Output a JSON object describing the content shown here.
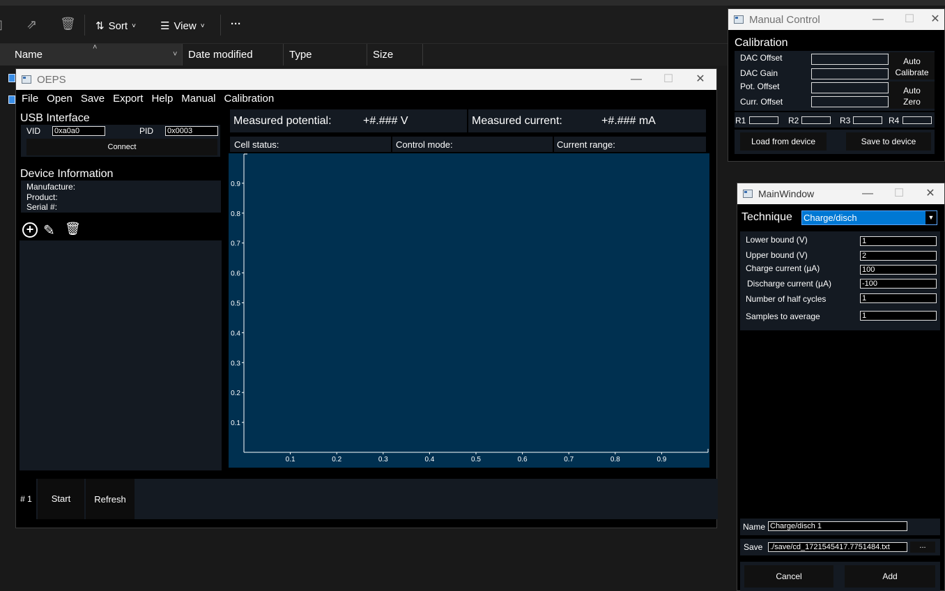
{
  "explorer": {
    "toolbar": {
      "sort_label": "Sort",
      "view_label": "View",
      "more_label": "···"
    },
    "columns": [
      "Name",
      "Date modified",
      "Type",
      "Size"
    ]
  },
  "oeps": {
    "title": "OEPS",
    "menu": [
      "File",
      "Open",
      "Save",
      "Export",
      "Help",
      "Manual",
      "Calibration"
    ],
    "usb": {
      "heading": "USB Interface",
      "vid_label": "VID",
      "vid_value": "0xa0a0",
      "pid_label": "PID",
      "pid_value": "0x0003",
      "connect_label": "Connect"
    },
    "device_info": {
      "heading": "Device Information",
      "manufacture": "Manufacture:",
      "product": "Product:",
      "serial": "Serial #:"
    },
    "readout": {
      "potential_label": "Measured potential:",
      "potential_value": "+#.### V",
      "current_label": "Measured current:",
      "current_value": "+#.### mA"
    },
    "status": {
      "cell": "Cell status:",
      "control": "Control mode:",
      "range": "Current range:"
    },
    "bottom": {
      "count": "# 1",
      "start_label": "Start",
      "refresh_label": "Refresh"
    }
  },
  "chart_data": {
    "type": "line",
    "series": [],
    "xlim": [
      0,
      1
    ],
    "ylim": [
      0,
      1
    ],
    "xticks": [
      "0.1",
      "0.2",
      "0.3",
      "0.4",
      "0.5",
      "0.6",
      "0.7",
      "0.8",
      "0.9"
    ],
    "yticks": [
      "0.1",
      "0.2",
      "0.3",
      "0.4",
      "0.5",
      "0.6",
      "0.7",
      "0.8",
      "0.9"
    ],
    "grid": false,
    "background": "#003050"
  },
  "manual": {
    "title": "Manual Control",
    "heading": "Calibration",
    "dac_offset": "DAC Offset",
    "dac_gain": "DAC Gain",
    "pot_offset": "Pot. Offset",
    "curr_offset": "Curr. Offset",
    "auto_calibrate_1": "Auto",
    "auto_calibrate_2": "Calibrate",
    "auto_zero_1": "Auto",
    "auto_zero_2": "Zero",
    "r1": "R1",
    "r2": "R2",
    "r3": "R3",
    "r4": "R4",
    "load_label": "Load from device",
    "save_label": "Save to device"
  },
  "mainwin": {
    "title": "MainWindow",
    "technique_label": "Technique",
    "technique_value": "Charge/disch",
    "params": [
      {
        "label": "Lower bound (V)",
        "value": "1"
      },
      {
        "label": "Upper bound (V)",
        "value": "2"
      },
      {
        "label": "Charge current (µA)",
        "value": "100"
      },
      {
        "label": "Discharge current (µA)",
        "value": "-100"
      },
      {
        "label": "Number of half cycles",
        "value": "1"
      },
      {
        "label": "Samples to average",
        "value": "1"
      }
    ],
    "name_label": "Name",
    "name_value": "Charge/disch 1",
    "save_label": "Save",
    "save_value": "./save/cd_1721545417.7751484.txt",
    "browse_label": "...",
    "cancel_label": "Cancel",
    "add_label": "Add"
  },
  "colors": {
    "accent": "#0078d4",
    "plot_bg": "#003050",
    "panel_bg": "#141a22"
  }
}
